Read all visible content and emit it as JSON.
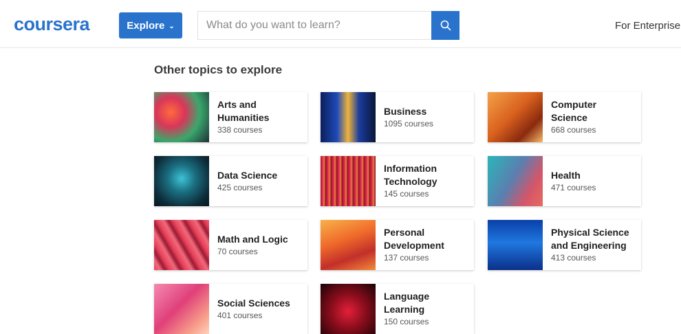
{
  "header": {
    "logo_text": "coursera",
    "explore_label": "Explore",
    "search_placeholder": "What do you want to learn?",
    "enterprise_label": "For Enterprise"
  },
  "section_title": "Other topics to explore",
  "topics": [
    {
      "name": "Arts and Humanities",
      "count": "338 courses"
    },
    {
      "name": "Business",
      "count": "1095 courses"
    },
    {
      "name": "Computer Science",
      "count": "668 courses"
    },
    {
      "name": "Data Science",
      "count": "425 courses"
    },
    {
      "name": "Information Technology",
      "count": "145 courses"
    },
    {
      "name": "Health",
      "count": "471 courses"
    },
    {
      "name": "Math and Logic",
      "count": "70 courses"
    },
    {
      "name": "Personal Development",
      "count": "137 courses"
    },
    {
      "name": "Physical Science and Engineering",
      "count": "413 courses"
    },
    {
      "name": "Social Sciences",
      "count": "401 courses"
    },
    {
      "name": "Language Learning",
      "count": "150 courses"
    }
  ],
  "colors": {
    "brand_blue": "#2a73cc"
  }
}
